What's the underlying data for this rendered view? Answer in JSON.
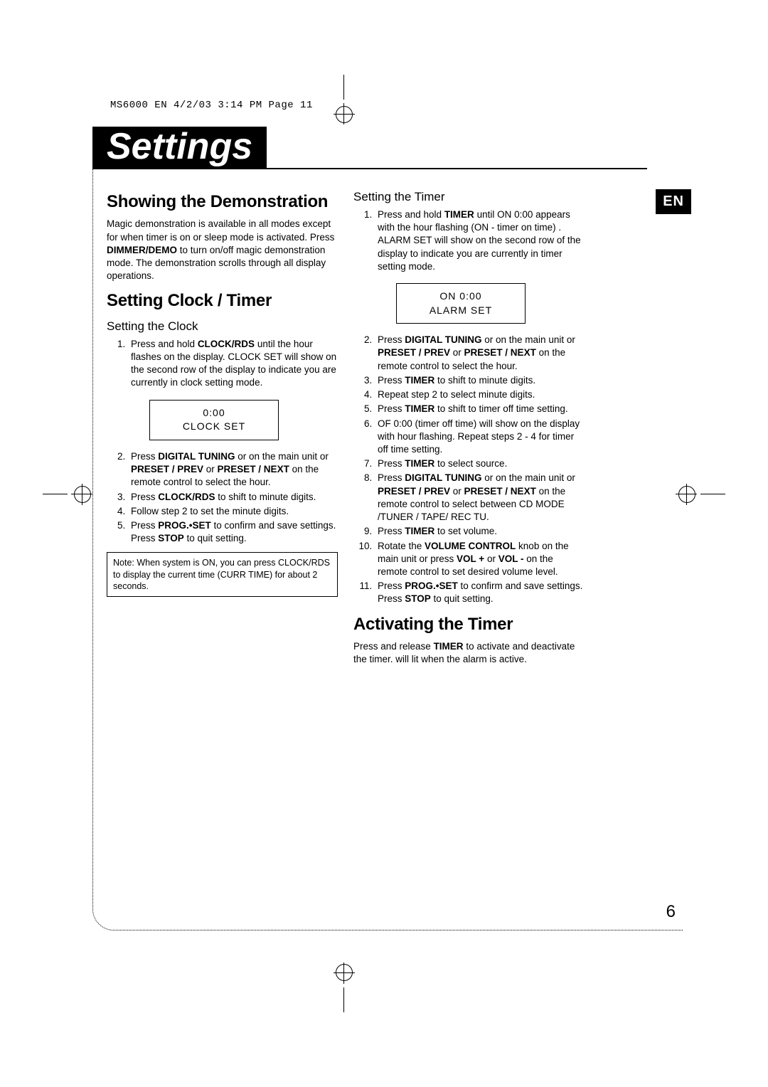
{
  "crop_header": "MS6000 EN  4/2/03  3:14 PM  Page 11",
  "title": "Settings",
  "lang_tab": "EN",
  "page_number": "6",
  "left": {
    "h2a": "Showing the Demonstration",
    "demo_p1": "Magic demonstration is available in all modes except for when timer is on or sleep mode is activated. Press ",
    "demo_b1": "DIMMER/DEMO",
    "demo_p2": "  to turn on/off magic demonstration mode. The demonstration scrolls through all display operations.",
    "h2b": "Setting Clock / Timer",
    "h3a": "Setting the Clock",
    "clock_li1a": "Press and hold ",
    "clock_li1b": "CLOCK/RDS",
    "clock_li1c": "  until the hour flashes on the display. CLOCK SET     will show on the second row of the display to indicate you are currently in clock setting mode.",
    "disp1_l1": "0:00",
    "disp1_l2": "CLOCK SET",
    "clock_li2a": "Press ",
    "clock_li2b": "DIGITAL TUNING",
    "clock_li2c": "         or         on the main unit or  ",
    "clock_li2d": "PRESET / PREV",
    "clock_li2e": "        or ",
    "clock_li2f": "PRESET / NEXT",
    "clock_li2g": "         on the remote control to select the hour.",
    "clock_li3a": "Press  ",
    "clock_li3b": "CLOCK/RDS",
    "clock_li3c": "  to shift to minute digits.",
    "clock_li4": "Follow step 2 to set the minute digits.",
    "clock_li5a": "Press  ",
    "clock_li5b": "PROG.•SET",
    "clock_li5c": "  to confirm and save settings. Press  ",
    "clock_li5d": "STOP",
    "clock_li5e": "      to quit setting.",
    "note": "Note: When system is ON, you can press CLOCK/RDS to display the current time (CURR TIME) for about 2 seconds."
  },
  "right": {
    "h3a": "Setting the Timer",
    "t_li1a": "Press and hold ",
    "t_li1b": "TIMER",
    "t_li1c": " until ON 0:00 appears  with the hour flashing (ON   - timer on time) .  ALARM SET     will show on the second row of the display to indicate you are currently in timer setting mode.",
    "disp2_l1": "ON 0:00",
    "disp2_l2": "ALARM SET",
    "t_li2a": "Press ",
    "t_li2b": "DIGITAL TUNING",
    "t_li2c": "        or        on the main  unit or ",
    "t_li2d": "PRESET / PREV",
    "t_li2e": "       or ",
    "t_li2f": "PRESET / NEXT",
    "t_li2g": "        on the remote control to select the hour.",
    "t_li3a": "Press ",
    "t_li3b": "TIMER",
    "t_li3c": " to shift to minute digits.",
    "t_li4": "Repeat step 2 to select minute digits.",
    "t_li5a": "Press ",
    "t_li5b": "TIMER",
    "t_li5c": " to shift to timer off time setting.",
    "t_li6": "OF 0:00         (timer off time) will show on the display with hour flashing. Repeat steps 2 - 4 for timer off time setting.",
    "t_li7a": "Press ",
    "t_li7b": "TIMER",
    "t_li7c": " to select source.",
    "t_li8a": "Press ",
    "t_li8b": "DIGITAL TUNING",
    "t_li8c": "       or        on the main unit or ",
    "t_li8d": "PRESET / PREV",
    "t_li8e": "       or ",
    "t_li8f": "PRESET /  NEXT",
    "t_li8g": "        on the remote control  to select between CD MODE /TUNER / TAPE/ REC TU.",
    "t_li9a": "Press ",
    "t_li9b": "TIMER",
    "t_li9c": " to set volume.",
    "t_li10a": "Rotate the ",
    "t_li10b": "VOLUME CONTROL",
    "t_li10c": " knob on the main unit or press ",
    "t_li10d": "VOL +",
    "t_li10e": " or ",
    "t_li10f": "VOL -",
    "t_li10g": " on the remote control to set desired volume level.",
    "t_li11a": "Press ",
    "t_li11b": "PROG.•SET",
    "t_li11c": " to confirm and save settings. Press ",
    "t_li11d": "STOP",
    "t_li11e": "       to quit setting.",
    "h2c": "Activating the Timer",
    "act_p1a": "Press and release ",
    "act_p1b": "TIMER",
    "act_p1c": " to activate and deactivate the timer.         will lit when the alarm is active."
  }
}
